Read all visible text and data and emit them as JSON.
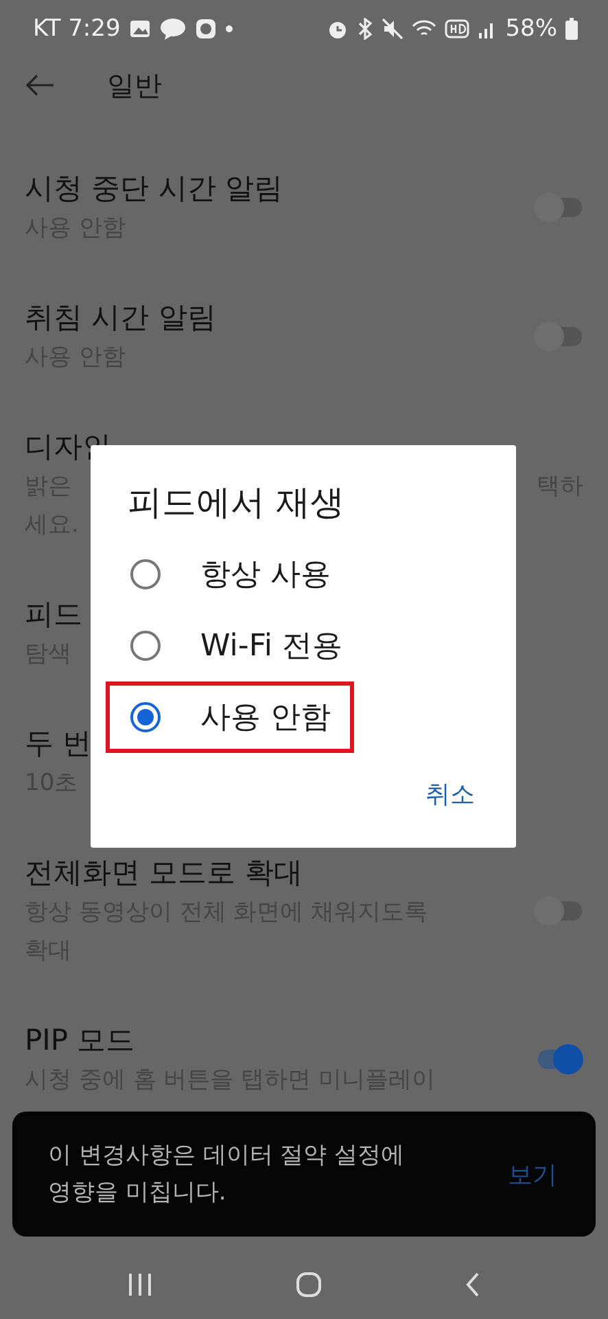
{
  "status_bar": {
    "carrier_time": "KT 7:29",
    "battery": "58%"
  },
  "header": {
    "title": "일반"
  },
  "items": [
    {
      "title": "시청 중단 시간 알림",
      "lines": [
        {
          "left": "사용 안함"
        }
      ],
      "switch": {
        "on": false
      }
    },
    {
      "title": "취침 시간 알림",
      "lines": [
        {
          "left": "사용 안함"
        }
      ],
      "switch": {
        "on": false
      }
    },
    {
      "title": "디자인",
      "lines": [
        {
          "left": "밝은",
          "right": "택하"
        },
        {
          "left": "세요."
        }
      ]
    },
    {
      "title": "피드",
      "lines": [
        {
          "left": "탐색"
        }
      ]
    },
    {
      "title": "두 번",
      "lines": [
        {
          "left": "10초"
        }
      ]
    },
    {
      "title": "전체화면 모드로 확대",
      "lines": [
        {
          "left": "항상 동영상이 전체 화면에 채워지도록"
        },
        {
          "left": "확대"
        }
      ],
      "switch": {
        "on": false
      }
    },
    {
      "title": "PIP 모드",
      "lines": [
        {
          "left": "시청 중에 홈 버튼을 탭하면 미니플레이"
        }
      ],
      "switch": {
        "on": true
      }
    }
  ],
  "dialog": {
    "title": "피드에서 재생",
    "options": [
      {
        "label": "항상 사용",
        "selected": false,
        "highlighted": false
      },
      {
        "label": "Wi-Fi 전용",
        "selected": false,
        "highlighted": false
      },
      {
        "label": "사용 안함",
        "selected": true,
        "highlighted": true
      }
    ],
    "cancel": "취소"
  },
  "snackbar": {
    "message": "이 변경사항은 데이터 절약 설정에 영향을 미칩니다.",
    "action": "보기"
  }
}
